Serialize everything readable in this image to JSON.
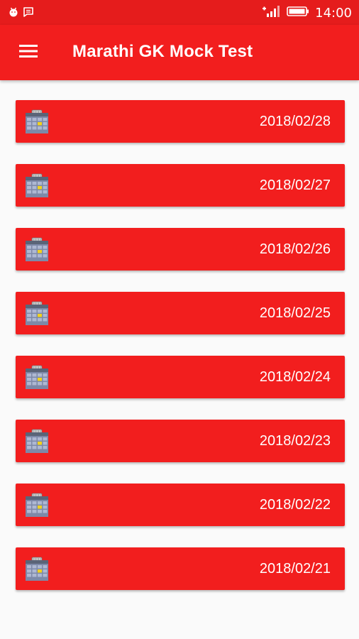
{
  "status_bar": {
    "time": "14:00",
    "left_icons": [
      "android-debug-icon",
      "message-icon"
    ],
    "right_icons": [
      "signal-icon",
      "battery-icon"
    ]
  },
  "app_bar": {
    "title": "Marathi GK Mock Test",
    "menu_icon": "hamburger-menu-icon"
  },
  "colors": {
    "accent": "#f21e1e",
    "status_bar": "#e51c1c",
    "background": "#fafafa",
    "text_on_accent": "#ffffff"
  },
  "tests": [
    {
      "date": "2018/02/28",
      "icon": "calendar-icon"
    },
    {
      "date": "2018/02/27",
      "icon": "calendar-icon"
    },
    {
      "date": "2018/02/26",
      "icon": "calendar-icon"
    },
    {
      "date": "2018/02/25",
      "icon": "calendar-icon"
    },
    {
      "date": "2018/02/24",
      "icon": "calendar-icon"
    },
    {
      "date": "2018/02/23",
      "icon": "calendar-icon"
    },
    {
      "date": "2018/02/22",
      "icon": "calendar-icon"
    },
    {
      "date": "2018/02/21",
      "icon": "calendar-icon"
    }
  ]
}
